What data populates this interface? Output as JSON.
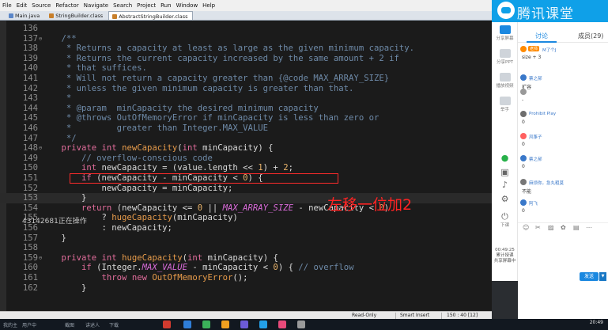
{
  "menu": [
    "File",
    "Edit",
    "Source",
    "Refactor",
    "Navigate",
    "Search",
    "Project",
    "Run",
    "Window",
    "Help"
  ],
  "tabs": [
    {
      "label": "Main.java",
      "active": false
    },
    {
      "label": "StringBuilder.class",
      "active": false
    },
    {
      "label": "AbstractStringBuilder.class",
      "active": true
    }
  ],
  "code_lines": [
    {
      "n": "136",
      "html": ""
    },
    {
      "n": "137",
      "fold": "⊖",
      "html": "    <span class='cm'>/**</span>"
    },
    {
      "n": "138",
      "html": "     <span class='cm'>* Returns a capacity at least as large as the given minimum capacity.</span>"
    },
    {
      "n": "139",
      "html": "     <span class='cm'>* Returns the current capacity increased by the same amount + 2 if</span>"
    },
    {
      "n": "140",
      "html": "     <span class='cm'>* that suffices.</span>"
    },
    {
      "n": "141",
      "html": "     <span class='cm'>* Will not return a capacity greater than {@code MAX_ARRAY_SIZE}</span>"
    },
    {
      "n": "142",
      "html": "     <span class='cm'>* unless the given minimum capacity is greater than that.</span>"
    },
    {
      "n": "143",
      "html": "     <span class='cm'>*</span>"
    },
    {
      "n": "144",
      "html": "     <span class='cm'>* @param  minCapacity the desired minimum capacity</span>"
    },
    {
      "n": "145",
      "html": "     <span class='cm'>* @throws OutOfMemoryError if minCapacity is less than zero or</span>"
    },
    {
      "n": "146",
      "html": "     <span class='cm'>*         greater than Integer.MAX_VALUE</span>"
    },
    {
      "n": "147",
      "html": "     <span class='cm'>*/</span>"
    },
    {
      "n": "148",
      "fold": "⊖",
      "html": "    <span class='kw'>private int</span> <span class='fn'>newCapacity</span>(<span class='kw'>int</span> minCapacity) {"
    },
    {
      "n": "149",
      "html": "        <span class='cm'>// overflow-conscious code</span>"
    },
    {
      "n": "150",
      "html": "        <span class='kw'>int</span> newCapacity = (value.length << <span class='num'>1</span>) + <span class='num'>2</span>;"
    },
    {
      "n": "151",
      "html": "        <span class='kw'>if</span> (newCapacity - minCapacity < <span class='num'>0</span>) {"
    },
    {
      "n": "152",
      "html": "            newCapacity = minCapacity;"
    },
    {
      "n": "153",
      "html": "        }"
    },
    {
      "n": "154",
      "html": "        <span class='kw'>return</span> (newCapacity <= <span class='num'>0</span> || <span class='cs'>MAX_ARRAY_SIZE</span> - newCapacity < <span class='num'>0</span>)"
    },
    {
      "n": "155",
      "html": "            ? <span class='fn'>hugeCapacity</span>(minCapacity)"
    },
    {
      "n": "156",
      "html": "            : newCapacity;"
    },
    {
      "n": "157",
      "html": "    }"
    },
    {
      "n": "158",
      "html": ""
    },
    {
      "n": "159",
      "fold": "⊖",
      "html": "    <span class='kw'>private int</span> <span class='fn'>hugeCapacity</span>(<span class='kw'>int</span> minCapacity) {"
    },
    {
      "n": "160",
      "html": "        <span class='kw'>if</span> (Integer.<span class='cs'>MAX_VALUE</span> - minCapacity < <span class='num'>0</span>) { <span class='cm'>// overflow</span>"
    },
    {
      "n": "161",
      "html": "            <span class='kw'>throw new</span> <span class='fn'>OutOfMemoryError</span>();"
    },
    {
      "n": "162",
      "html": "        }"
    }
  ],
  "annotation": "左移一位加2",
  "watermark": "43142681正在操作",
  "status": {
    "mode": "Read-Only",
    "insert": "Smart Insert",
    "position": "150 : 40 [12]"
  },
  "taskbar": {
    "labels": [
      "我的主",
      "用户中",
      "截图",
      "讲述人",
      "下载"
    ],
    "time": "20:49"
  },
  "qq": {
    "title": "腾讯课堂",
    "tab_discuss": "讨论",
    "tab_members": "成员(29)",
    "rail": [
      "分享屏幕",
      "分享PPT",
      "播放视频",
      "举手",
      "下课"
    ],
    "timer_value": "00:49:25",
    "timer_label1": "累计授课",
    "timer_label2": "共享屏幕中",
    "messages": [
      {
        "nick": "M了个J",
        "text": "size + 3",
        "color": "#ff8a00",
        "badge": "老师"
      },
      {
        "nick": "蔡之郝",
        "text": "扩容",
        "color": "#3a78c9"
      },
      {
        "nick": "",
        "text": "-",
        "color": "#999999"
      },
      {
        "nick": "Prohibit Play",
        "text": "0",
        "color": "#6e6e6e"
      },
      {
        "nick": "风筝子",
        "text": "0",
        "color": "#ff6060"
      },
      {
        "nick": "蔡之郝",
        "text": "0",
        "color": "#3a78c9"
      },
      {
        "nick": "麻烦你。急丸粗莫",
        "text": "不能",
        "color": "#777777"
      },
      {
        "nick": "阿飞",
        "text": "0",
        "color": "#3a78c9"
      }
    ],
    "send_label": "发送",
    "send_more": "▼"
  }
}
